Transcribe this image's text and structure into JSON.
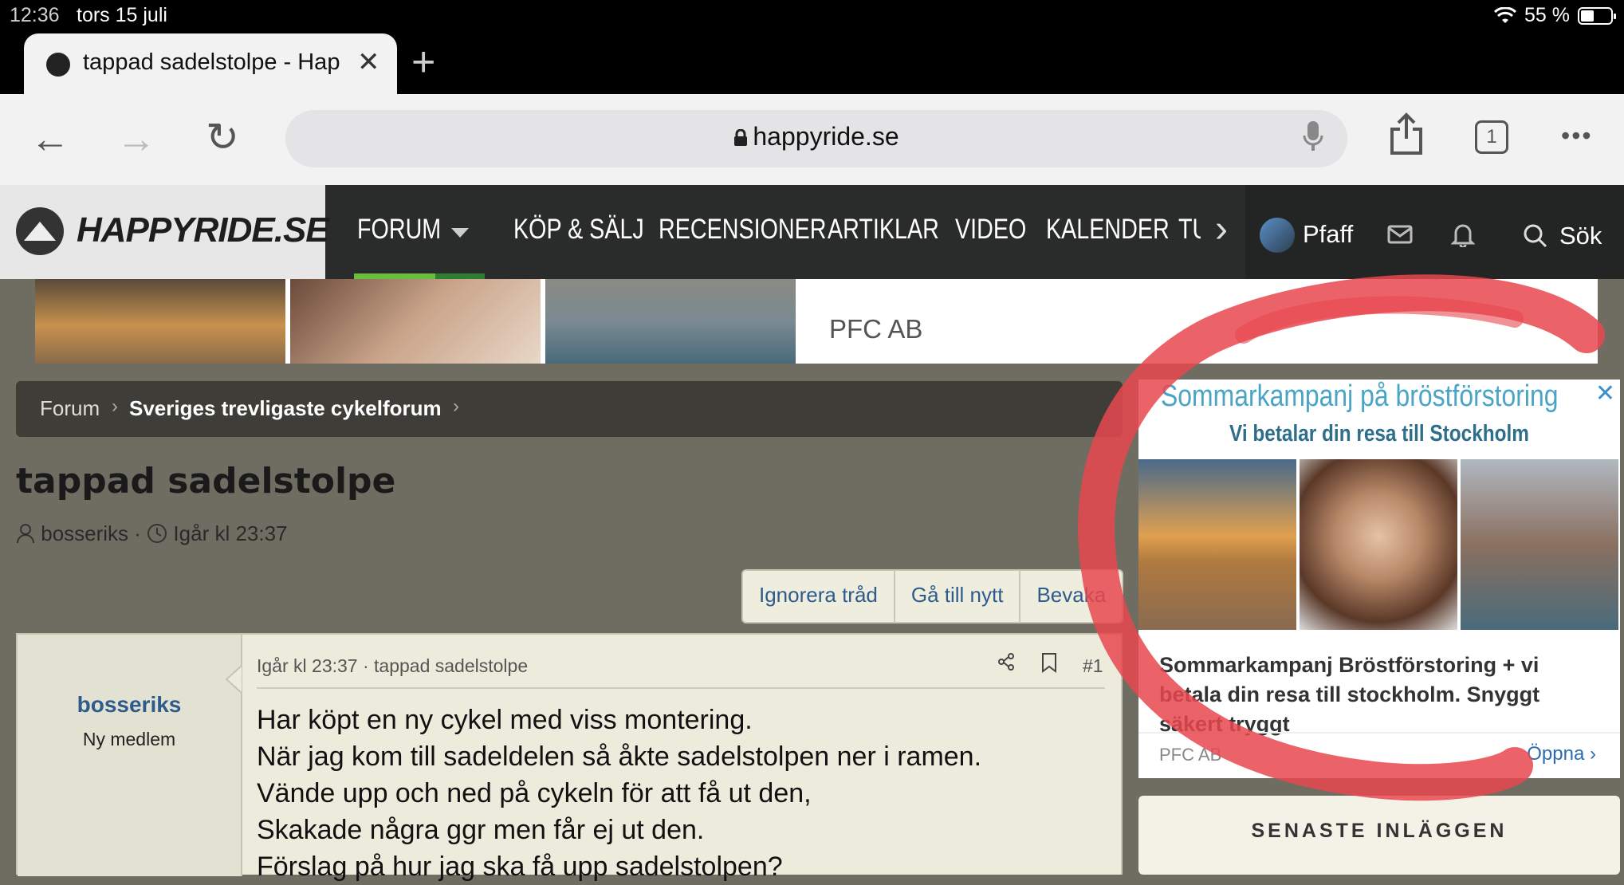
{
  "status_bar": {
    "time": "12:36",
    "date": "tors 15 juli",
    "battery": "55 %"
  },
  "tab": {
    "title": "tappad sadelstolpe - Hap",
    "close": "✕",
    "new_tab": "+"
  },
  "toolbar": {
    "back": "←",
    "forward": "→",
    "reload": "↻",
    "url": "happyride.se",
    "share": "⇪",
    "tab_count": "1",
    "more": "•••"
  },
  "site": {
    "logo": "HAPPYRIDE.SE",
    "nav": [
      "FORUM",
      "KÖP & SÄLJ",
      "RECENSIONER",
      "ARTIKLAR",
      "VIDEO",
      "KALENDER",
      "TU"
    ],
    "nav_more": "›",
    "user": "Pfaff",
    "search": "Sök"
  },
  "top_ad": {
    "advertiser": "PFC AB"
  },
  "breadcrumb": {
    "items": [
      "Forum",
      "Sveriges trevligaste cykelforum"
    ]
  },
  "thread": {
    "title": "tappad sadelstolpe",
    "author": "bosseriks",
    "date": "Igår kl 23:37",
    "actions": [
      "Ignorera tråd",
      "Gå till nytt",
      "Bevaka"
    ]
  },
  "post": {
    "username": "bosseriks",
    "role": "Ny medlem",
    "header": "Igår kl 23:37 · tappad sadelstolpe",
    "number": "#1",
    "lines": [
      "Har köpt en ny cykel med viss montering.",
      "När jag kom till sadeldelen så åkte sadelstolpen ner i ramen.",
      "Vände upp och ned på cykeln för att få ut den,",
      "Skakade några ggr men får ej ut den.",
      "Förslag på hur jag ska få upp sadelstolpen?"
    ]
  },
  "side_ad": {
    "headline": "Sommarkampanj på bröstförstoring",
    "subheadline": "Vi betalar din resa till Stockholm",
    "text": "Sommarkampanj Bröstförstoring + vi betala din resa till stockholm. Snyggt säkert tryggt",
    "advertiser": "PFC AB",
    "open": "Öppna"
  },
  "latest": {
    "title": "SENASTE INLÄGGEN"
  },
  "colors": {
    "accent_green": "#6bbd3e",
    "link_blue": "#2d5b8c",
    "annotation_red": "#e8484f"
  }
}
